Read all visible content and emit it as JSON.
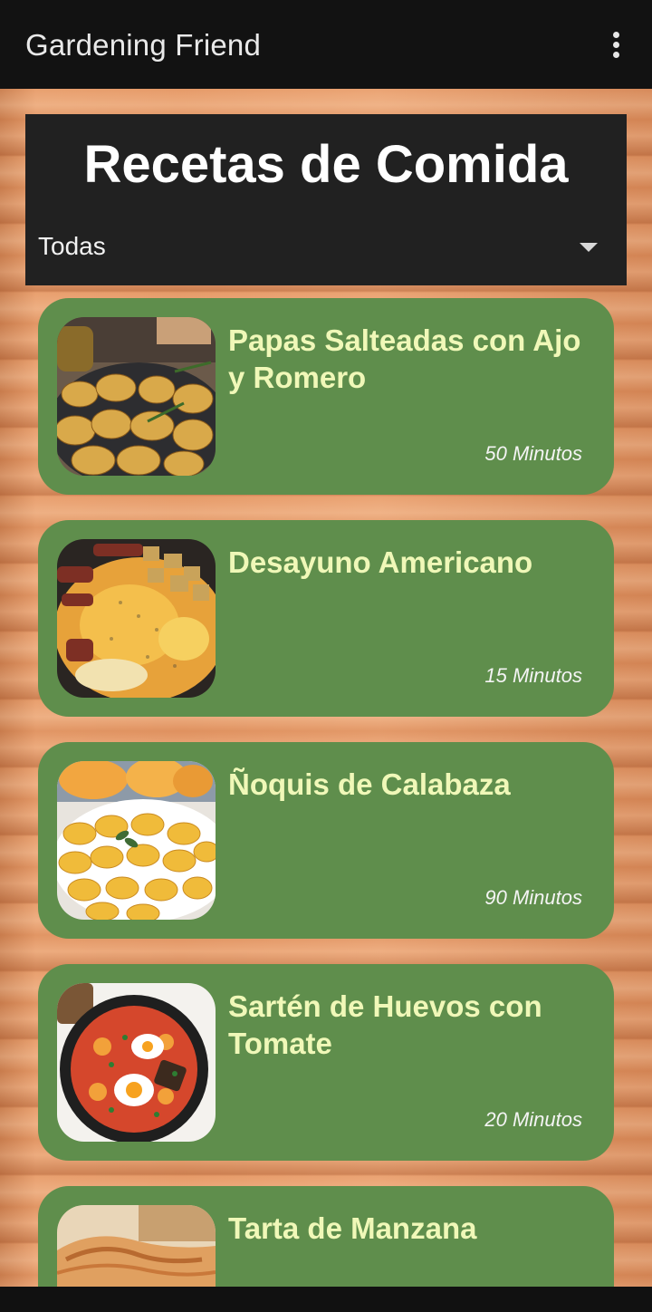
{
  "app": {
    "title": "Gardening Friend",
    "menu_icon": "more-vert-icon"
  },
  "header": {
    "title": "Recetas de Comida",
    "filter": {
      "selected": "Todas",
      "icon": "dropdown-arrow-icon"
    }
  },
  "recipes": [
    {
      "title": "Papas Salteadas con Ajo y Romero",
      "time": "50 Minutos",
      "image": "roasted-potatoes-image"
    },
    {
      "title": "Desayuno Americano",
      "time": "15 Minutos",
      "image": "american-breakfast-image"
    },
    {
      "title": "Ñoquis de Calabaza",
      "time": "90 Minutos",
      "image": "pumpkin-gnocchi-image"
    },
    {
      "title": "Sartén de Huevos con Tomate",
      "time": "20 Minutos",
      "image": "egg-tomato-skillet-image"
    },
    {
      "title": "Tarta de Manzana",
      "image": "apple-tart-image"
    }
  ],
  "colors": {
    "appbar": "#121212",
    "panel": "#212121",
    "card": "#5f8e4c",
    "card_title": "#f0f8b8",
    "wood": "#e69a68"
  }
}
